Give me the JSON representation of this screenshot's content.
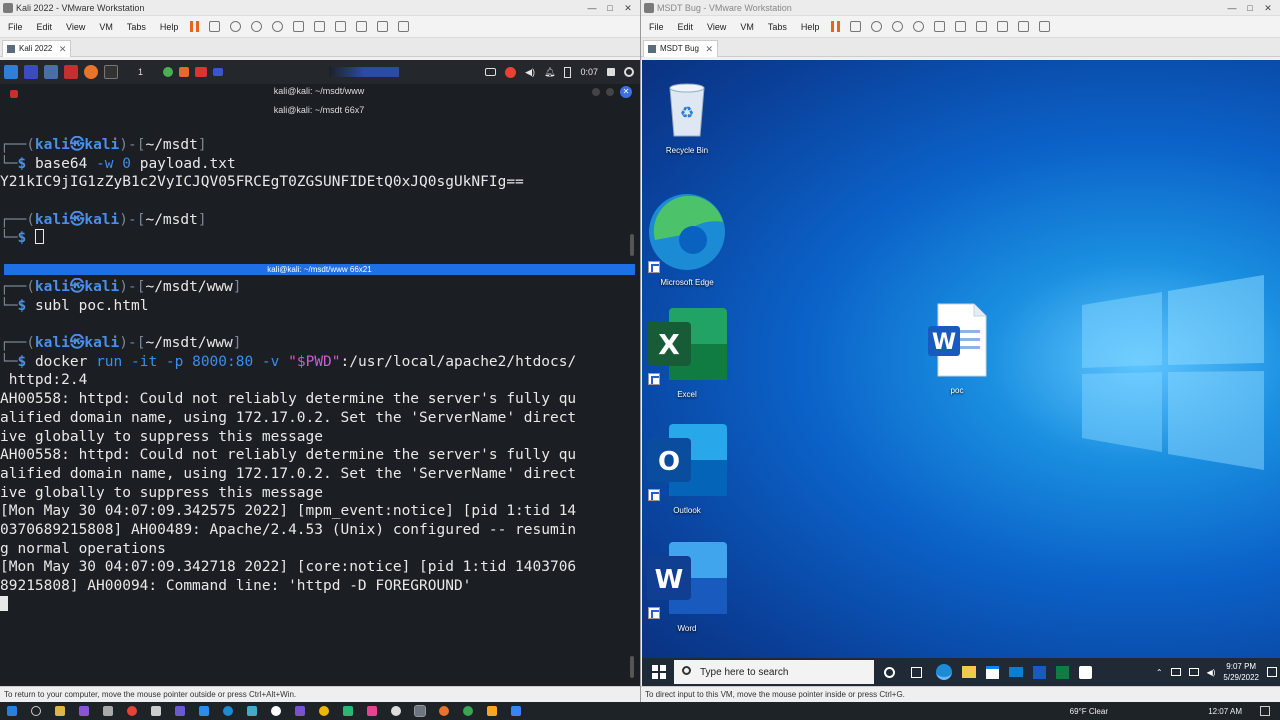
{
  "left_window": {
    "title": "Kali 2022 - VMware Workstation",
    "menu": [
      "File",
      "Edit",
      "View",
      "VM",
      "Tabs",
      "Help"
    ],
    "tab": "Kali 2022",
    "status": "To return to your computer, move the mouse pointer outside or press Ctrl+Alt+Win."
  },
  "right_window": {
    "title": "MSDT Bug - VMware Workstation",
    "menu": [
      "File",
      "Edit",
      "View",
      "VM",
      "Tabs",
      "Help"
    ],
    "tab": "MSDT Bug",
    "status": "To direct input to this VM, move the mouse pointer inside or press Ctrl+G."
  },
  "kali": {
    "panel_workspace": "1",
    "panel_time": "0:07",
    "terminal_window_title": "kali@kali: ~/msdt/www",
    "pane1_title": "kali@kali: ~/msdt 66x7",
    "pane2_title": "kali@kali: ~/msdt/www 66x21",
    "pane1": {
      "prompt_user": "kali",
      "prompt_host": "kali",
      "prompt_dir": "~/msdt",
      "cmd1": "base64",
      "cmd1_flag": "-w 0",
      "cmd1_arg": "payload.txt",
      "output": "Y21kIC9jIG1zZyB1c2VyICJQV05FRCEgT0ZGSUNFIDEtQ0xJQ0sgUkNFIg=="
    },
    "pane2": {
      "prompt_dir": "~/msdt/www",
      "cmd_subl": "subl",
      "cmd_subl_arg": "poc.html",
      "cmd_docker": "docker",
      "cmd_docker_args": "run -it -p 8000:80 -v ",
      "pwd_var": "\"$PWD\"",
      "cmd_docker_tail": ":/usr/local/apache2/htdocs/",
      "cmd_docker_wrap": " httpd:2.4",
      "log": [
        "AH00558: httpd: Could not reliably determine the server's fully qu",
        "alified domain name, using 172.17.0.2. Set the 'ServerName' direct",
        "ive globally to suppress this message",
        "AH00558: httpd: Could not reliably determine the server's fully qu",
        "alified domain name, using 172.17.0.2. Set the 'ServerName' direct",
        "ive globally to suppress this message",
        "[Mon May 30 04:07:09.342575 2022] [mpm_event:notice] [pid 1:tid 14",
        "0370689215808] AH00489: Apache/2.4.53 (Unix) configured -- resumin",
        "g normal operations",
        "[Mon May 30 04:07:09.342718 2022] [core:notice] [pid 1:tid 1403706",
        "89215808] AH00094: Command line: 'httpd -D FOREGROUND'"
      ]
    }
  },
  "windows": {
    "icons": [
      {
        "label": "Recycle Bin"
      },
      {
        "label": "Microsoft Edge"
      },
      {
        "label": "Excel"
      },
      {
        "label": "Outlook"
      },
      {
        "label": "Word"
      },
      {
        "label": "poc"
      }
    ],
    "search_placeholder": "Type here to search",
    "weather": "69°F  Clear",
    "clock_time": "9:07 PM",
    "clock_date": "5/29/2022"
  },
  "host_taskbar": {
    "weather": "69°F  Clear",
    "time": "12:07 AM"
  },
  "colors": {
    "kali_blue": "#3b8ef0",
    "pane_title_bar": "#1f6fe6",
    "win_taskbar": "#1f2a36",
    "pause_orange": "#e8641b"
  }
}
